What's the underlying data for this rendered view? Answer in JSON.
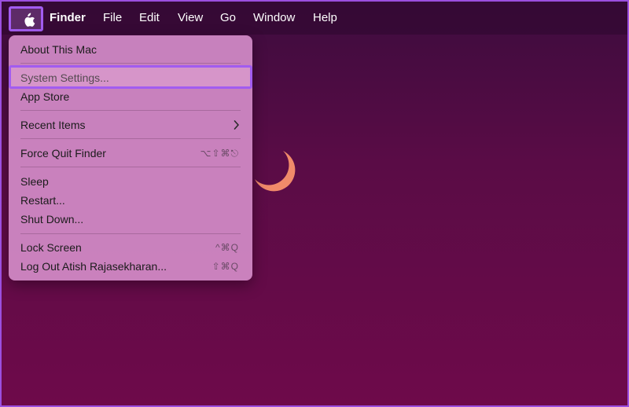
{
  "menubar": {
    "apple_icon": "apple-logo-icon",
    "items": [
      {
        "label": "Finder"
      },
      {
        "label": "File"
      },
      {
        "label": "Edit"
      },
      {
        "label": "View"
      },
      {
        "label": "Go"
      },
      {
        "label": "Window"
      },
      {
        "label": "Help"
      }
    ]
  },
  "apple_menu": {
    "items": [
      {
        "label": "About This Mac",
        "shortcut": ""
      },
      {
        "label": "System Settings...",
        "shortcut": "",
        "highlighted": true
      },
      {
        "label": "App Store",
        "shortcut": ""
      },
      {
        "label": "Recent Items",
        "shortcut": "",
        "submenu": true
      },
      {
        "label": "Force Quit Finder",
        "shortcut": "⌥⇧⌘⎋"
      },
      {
        "label": "Sleep",
        "shortcut": ""
      },
      {
        "label": "Restart...",
        "shortcut": ""
      },
      {
        "label": "Shut Down...",
        "shortcut": ""
      },
      {
        "label": "Lock Screen",
        "shortcut": "^⌘Q"
      },
      {
        "label": "Log Out Atish Rajasekharan...",
        "shortcut": "⇧⌘Q"
      }
    ]
  },
  "desktop": {
    "wallpaper_icon": "crescent-moon-icon"
  },
  "colors": {
    "highlight_outline": "#a25cf0",
    "menu_background": "#d38cc8",
    "desktop_top": "#3d0c3e",
    "desktop_bottom": "#6e0a4a",
    "moon": "#f08a6a"
  }
}
